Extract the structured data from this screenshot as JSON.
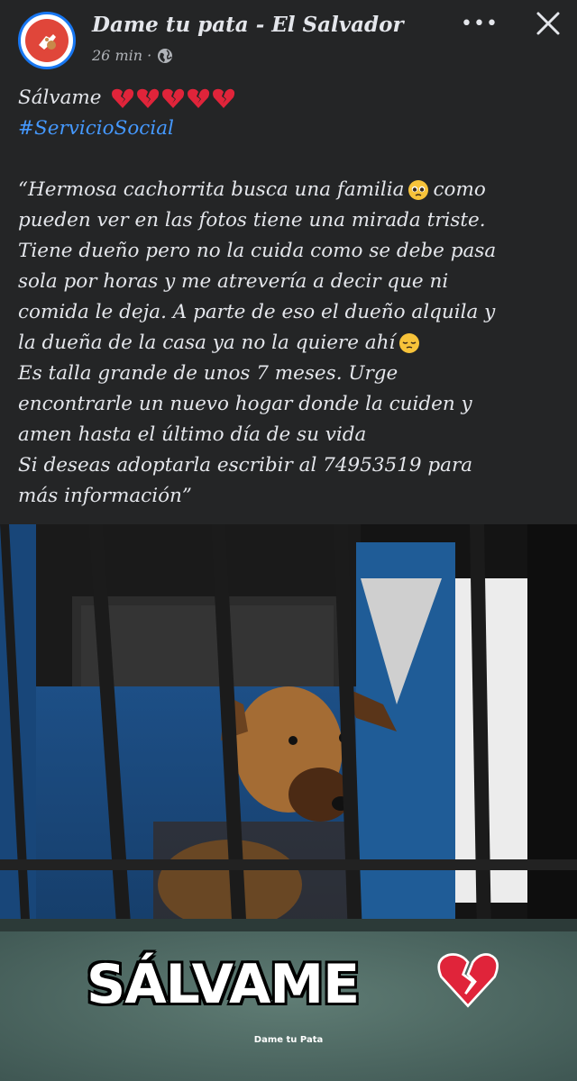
{
  "post": {
    "page_name": "Dame tu pata - El Salvador",
    "time": "26 min ·",
    "more_label": "•••",
    "title": "Sálvame",
    "hashtag": "#ServicioSocial",
    "body_lines": [
      "“Hermosa cachorrita busca una familia",
      "como",
      "pueden ver en las fotos tiene una mirada triste.",
      "Tiene dueño pero no la cuida como se debe pasa",
      "sola por horas y me atrevería a decir  que ni",
      "comida le deja. A parte de eso el dueño alquila y",
      "la dueña de la casa ya no la quiere ahí",
      "Es talla grande de unos 7 meses. Urge",
      "encontrarle un nuevo hogar donde la cuiden y",
      "amen hasta el último día de su vida",
      "Si deseas adoptarla escribir al 74953519 para",
      "más información”"
    ]
  },
  "image": {
    "overlay_title": "SÁLVAME",
    "watermark": "Dame tu Pata"
  },
  "icons": {
    "broken_heart": "broken-heart-icon",
    "globe": "globe-icon",
    "pleading_face": "pleading-face-icon",
    "pensive_face": "pensive-face-icon",
    "close": "close-icon"
  },
  "colors": {
    "background": "#242526",
    "hashtag": "#4599ff",
    "heart": "#e0243a"
  }
}
